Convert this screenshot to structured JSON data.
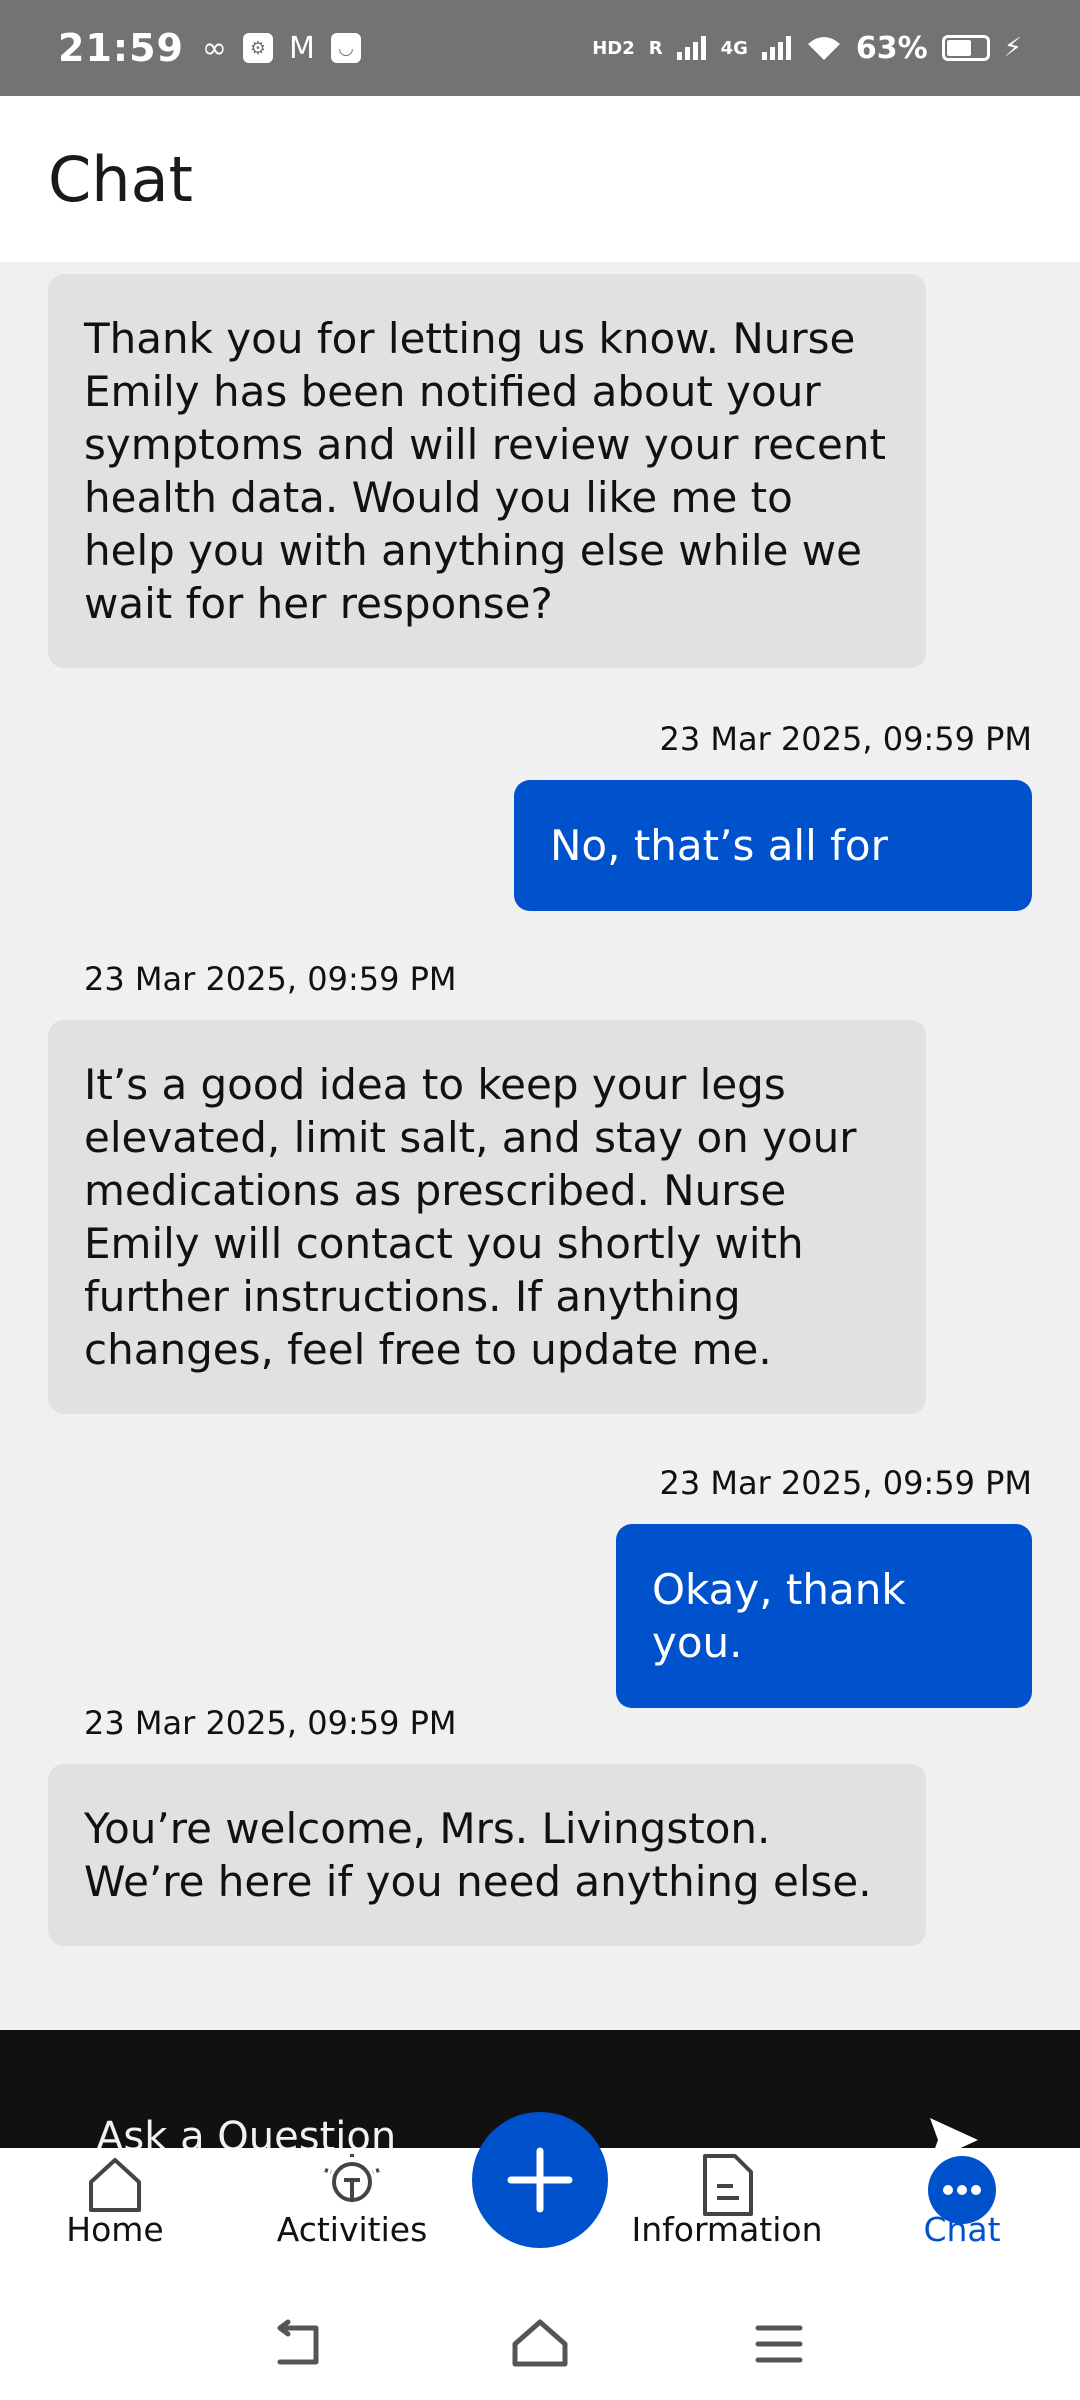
{
  "status_bar": {
    "time": "21:59",
    "network_label_1": "HD2",
    "network_label_2": "R",
    "network_label_3": "4G",
    "battery": "63%",
    "battery_level": 0.63,
    "icons": [
      "voicemail-icon",
      "usb-debug-icon",
      "gmail-icon",
      "message-icon",
      "signal-icon",
      "wifi-icon",
      "battery-icon",
      "charging-icon"
    ]
  },
  "header": {
    "title": "Chat"
  },
  "messages": [
    {
      "sender": "bot",
      "timestamp": "",
      "text": "Thank you for letting us know. Nurse Emily has been notified about your symptoms and will review your recent health data. Would you like me to help you with anything else while we wait for her response?"
    },
    {
      "sender": "user",
      "timestamp": "23 Mar 2025, 09:59 PM",
      "text": "No, that’s all for"
    },
    {
      "sender": "bot",
      "timestamp": "23 Mar 2025, 09:59 PM",
      "text": "It’s a good idea to keep your legs elevated, limit salt, and stay on your medications as prescribed. Nurse Emily will contact you shortly with further instructions. If anything changes, feel free to update me."
    },
    {
      "sender": "user",
      "timestamp": "23 Mar 2025, 09:59 PM",
      "text": "Okay, thank you."
    },
    {
      "sender": "bot",
      "timestamp": "23 Mar 2025, 09:59 PM",
      "text": "You’re welcome, Mrs. Livingston. We’re here if you need anything else."
    }
  ],
  "composer": {
    "placeholder": "Ask a Question"
  },
  "bottom_nav": {
    "home": "Home",
    "activities": "Activities",
    "information": "Information",
    "chat": "Chat",
    "active": "chat"
  },
  "colors": {
    "accent": "#0052cc",
    "bot_bubble": "#e1e1e1",
    "background": "#f0f0f0",
    "status_bar": "#737373",
    "composer": "#111111"
  }
}
